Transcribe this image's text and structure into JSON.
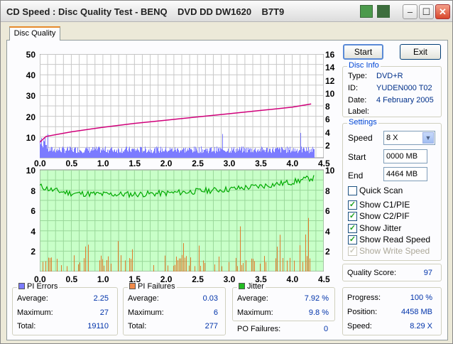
{
  "window": {
    "title": "CD Speed : Disc Quality Test - BENQ    DVD DD DW1620    B7T9",
    "buttons": {
      "minimize": "–",
      "maximize": "☐",
      "close": "✕"
    }
  },
  "tab": {
    "label": "Disc Quality"
  },
  "actions": {
    "start": "Start",
    "exit": "Exit"
  },
  "disc_info": {
    "legend": "Disc Info",
    "type_label": "Type:",
    "type": "DVD+R",
    "id_label": "ID:",
    "id": "YUDEN000 T02",
    "date_label": "Date:",
    "date": "4 February 2005",
    "label_label": "Label:",
    "label": ""
  },
  "settings": {
    "legend": "Settings",
    "speed_label": "Speed",
    "speed": "8 X",
    "start_label": "Start",
    "start": "0000 MB",
    "end_label": "End",
    "end": "4464 MB",
    "quick_scan": "Quick Scan",
    "show_c1": "Show C1/PIE",
    "show_c2": "Show C2/PIF",
    "show_jitter": "Show Jitter",
    "show_read": "Show Read Speed",
    "show_write": "Show Write Speed",
    "checks": {
      "quick_scan": false,
      "show_c1": true,
      "show_c2": true,
      "show_jitter": true,
      "show_read": true,
      "show_write": true
    }
  },
  "quality": {
    "label": "Quality Score:",
    "value": "97"
  },
  "progress": {
    "progress_label": "Progress:",
    "progress": "100 %",
    "position_label": "Position:",
    "position": "4458 MB",
    "speed_label": "Speed:",
    "speed": "8.29 X"
  },
  "pi_errors": {
    "legend": "PI Errors",
    "avg_label": "Average:",
    "avg": "2.25",
    "max_label": "Maximum:",
    "max": "27",
    "total_label": "Total:",
    "total": "19110"
  },
  "pi_failures": {
    "legend": "PI Failures",
    "avg_label": "Average:",
    "avg": "0.03",
    "max_label": "Maximum:",
    "max": "6",
    "total_label": "Total:",
    "total": "277"
  },
  "jitter": {
    "legend": "Jitter",
    "avg_label": "Average:",
    "avg": "7.92 %",
    "max_label": "Maximum:",
    "max": "9.8 %",
    "po_label": "PO Failures:",
    "po": "0"
  },
  "colors": {
    "pie": "#7b7bff",
    "pif": "#e07a2a",
    "jitter": "#00aa00",
    "speed": "#d0007a",
    "grid_bg_bottom": "#c8ffc8"
  },
  "chart_data": [
    {
      "type": "area",
      "name": "PI Errors / Read Speed",
      "x_ticks": [
        "0.0",
        "0.5",
        "1.0",
        "1.5",
        "2.0",
        "2.5",
        "3.0",
        "3.5",
        "4.0",
        "4.5"
      ],
      "y_left_ticks": [
        "50",
        "40",
        "30",
        "20",
        "10"
      ],
      "y_right_ticks": [
        "16",
        "14",
        "12",
        "10",
        "8",
        "6",
        "4",
        "2"
      ],
      "xlim": [
        0,
        4.5
      ],
      "ylim_left": [
        0,
        50
      ],
      "ylim_right": [
        0,
        16
      ],
      "pie_avg": 2.25,
      "pie_max": 27,
      "read_speed": {
        "x": [
          0,
          0.1,
          0.5,
          1.0,
          1.5,
          2.0,
          2.5,
          3.0,
          3.5,
          4.0,
          4.3
        ],
        "y": [
          2.4,
          3.3,
          4.0,
          4.7,
          5.3,
          5.8,
          6.3,
          6.8,
          7.3,
          7.8,
          8.3
        ]
      }
    },
    {
      "type": "bar",
      "name": "PI Failures / Jitter",
      "x_ticks": [
        "0.0",
        "0.5",
        "1.0",
        "1.5",
        "2.0",
        "2.5",
        "3.0",
        "3.5",
        "4.0",
        "4.5"
      ],
      "y_left_ticks": [
        "10",
        "8",
        "6",
        "4",
        "2"
      ],
      "y_right_ticks": [
        "10",
        "8",
        "6",
        "4",
        "2"
      ],
      "xlim": [
        0,
        4.5
      ],
      "ylim": [
        0,
        10
      ],
      "pif_max": 6,
      "jitter": {
        "x": [
          0,
          0.2,
          0.5,
          1.0,
          1.5,
          2.0,
          2.5,
          3.0,
          3.5,
          4.0,
          4.3
        ],
        "y": [
          8.4,
          8.0,
          7.7,
          7.6,
          7.6,
          7.7,
          7.9,
          8.1,
          8.4,
          8.8,
          9.2
        ]
      }
    }
  ]
}
